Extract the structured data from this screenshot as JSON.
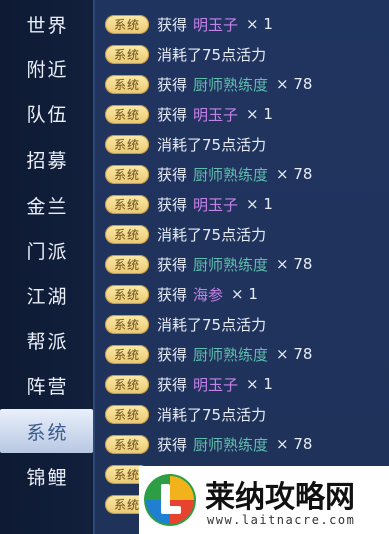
{
  "sidebar": {
    "items": [
      {
        "label": "世界",
        "active": false
      },
      {
        "label": "附近",
        "active": false
      },
      {
        "label": "队伍",
        "active": false
      },
      {
        "label": "招募",
        "active": false
      },
      {
        "label": "金兰",
        "active": false
      },
      {
        "label": "门派",
        "active": false
      },
      {
        "label": "江湖",
        "active": false
      },
      {
        "label": "帮派",
        "active": false
      },
      {
        "label": "阵营",
        "active": false
      },
      {
        "label": "系统",
        "active": true
      },
      {
        "label": "锦鲤",
        "active": false
      }
    ]
  },
  "log": {
    "badge": "系统",
    "entries": [
      {
        "verb": "获得",
        "item": "明玉子",
        "color": "purple",
        "qty": "× 1"
      },
      {
        "verb": "",
        "text": "消耗了75点活力"
      },
      {
        "verb": "获得",
        "item": "厨师熟练度",
        "color": "teal",
        "qty": "× 78"
      },
      {
        "verb": "获得",
        "item": "明玉子",
        "color": "purple",
        "qty": "× 1"
      },
      {
        "verb": "",
        "text": "消耗了75点活力"
      },
      {
        "verb": "获得",
        "item": "厨师熟练度",
        "color": "teal",
        "qty": "× 78"
      },
      {
        "verb": "获得",
        "item": "明玉子",
        "color": "purple",
        "qty": "× 1"
      },
      {
        "verb": "",
        "text": "消耗了75点活力"
      },
      {
        "verb": "获得",
        "item": "厨师熟练度",
        "color": "teal",
        "qty": "× 78"
      },
      {
        "verb": "获得",
        "item": "海参",
        "color": "purple",
        "qty": "× 1"
      },
      {
        "verb": "",
        "text": "消耗了75点活力"
      },
      {
        "verb": "获得",
        "item": "厨师熟练度",
        "color": "teal",
        "qty": "× 78"
      },
      {
        "verb": "获得",
        "item": "明玉子",
        "color": "purple",
        "qty": "× 1"
      },
      {
        "verb": "",
        "text": "消耗了75点活力"
      },
      {
        "verb": "获得",
        "item": "厨师熟练度",
        "color": "teal",
        "qty": "× 78"
      },
      {
        "verb": "",
        "text": ""
      },
      {
        "verb": "",
        "text": ""
      }
    ]
  },
  "colors": {
    "purple": "#c483e8",
    "teal": "#5fbfae",
    "badge_bg": "#fbeaa6",
    "active_tab": "#e9f0fb"
  },
  "watermark": {
    "title": "莱纳攻略网",
    "url": "www.laitnacre.com",
    "logo_letter": "L"
  }
}
